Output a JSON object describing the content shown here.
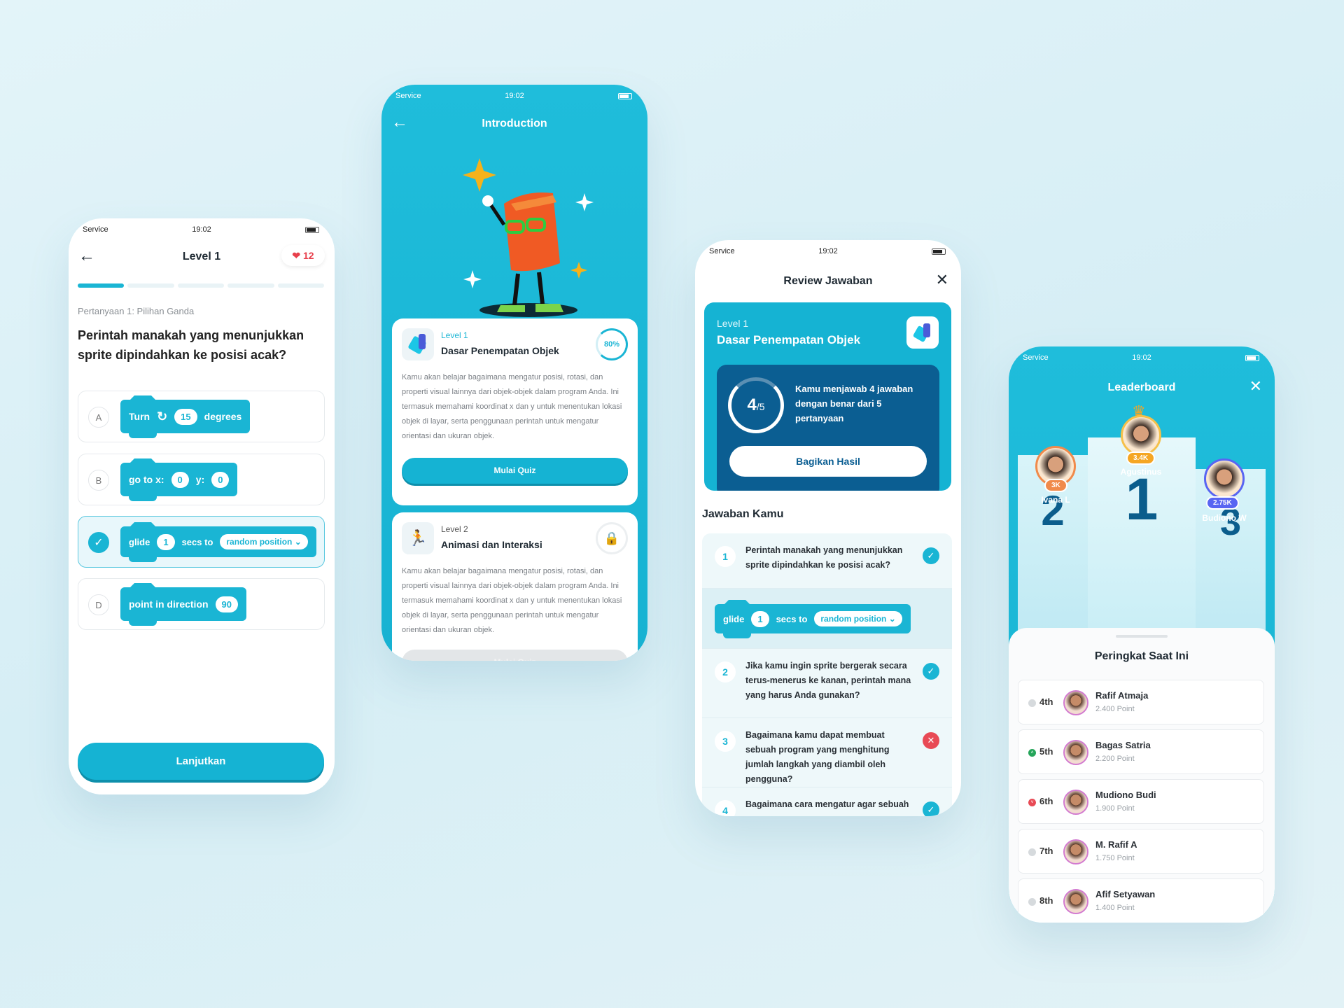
{
  "status": {
    "carrier": "Service",
    "time": "19:02"
  },
  "quiz": {
    "title": "Level 1",
    "lives": "12",
    "progress": {
      "current": 1,
      "total": 5
    },
    "question_label": "Pertanyaan 1: Pilihan Ganda",
    "question": "Perintah manakah yang menunjukkan sprite dipindahkan ke posisi acak?",
    "options": [
      {
        "letter": "A",
        "parts": [
          "Turn",
          "15",
          "degrees"
        ]
      },
      {
        "letter": "B",
        "parts": [
          "go to x:",
          "0",
          "y:",
          "0"
        ]
      },
      {
        "letter": "C",
        "selected": true,
        "parts": [
          "glide",
          "1",
          "secs to",
          "random position"
        ]
      },
      {
        "letter": "D",
        "parts": [
          "point in direction",
          "90"
        ]
      }
    ],
    "continue_label": "Lanjutkan"
  },
  "intro": {
    "title": "Introduction",
    "levels": [
      {
        "level": "Level 1",
        "name": "Dasar Penempatan Objek",
        "progress": "80%",
        "description": "Kamu akan belajar bagaimana mengatur posisi, rotasi, dan properti visual lainnya dari objek-objek dalam program Anda. Ini termasuk memahami koordinat x dan y untuk menentukan lokasi objek di layar, serta penggunaan perintah untuk mengatur orientasi dan ukuran objek.",
        "button": "Mulai Quiz"
      },
      {
        "level": "Level 2",
        "name": "Animasi dan Interaksi",
        "locked": true,
        "description": "Kamu akan belajar bagaimana mengatur posisi, rotasi, dan properti visual lainnya dari objek-objek dalam program Anda. Ini termasuk memahami koordinat x dan y untuk menentukan lokasi objek di layar, serta penggunaan perintah untuk mengatur orientasi dan ukuran objek.",
        "button": "Mulai Quiz"
      }
    ]
  },
  "review": {
    "title": "Review Jawaban",
    "level": "Level 1",
    "name": "Dasar Penempatan Objek",
    "score": "4",
    "score_total": "/5",
    "summary": "Kamu menjawab 4 jawaban dengan benar dari 5 pertanyaan",
    "share_label": "Bagikan Hasil",
    "answers_heading": "Jawaban Kamu",
    "answers": [
      {
        "n": "1",
        "q": "Perintah manakah yang menunjukkan sprite dipindahkan ke posisi acak?",
        "correct": true
      },
      {
        "n": "2",
        "q": "Jika kamu ingin sprite bergerak secara terus-menerus ke kanan, perintah mana yang harus Anda gunakan?",
        "correct": true
      },
      {
        "n": "3",
        "q": "Bagaimana kamu dapat membuat sebuah program yang menghitung jumlah langkah yang diambil oleh pengguna?",
        "correct": false
      },
      {
        "n": "4",
        "q": "Bagaimana cara mengatur agar sebuah",
        "correct": true
      }
    ],
    "answer_block": [
      "glide",
      "1",
      "secs to",
      "random position"
    ]
  },
  "leaderboard": {
    "title": "Leaderboard",
    "podium": [
      {
        "place": "1",
        "name": "Agustinus",
        "score": "3.4K"
      },
      {
        "place": "2",
        "name": "Ivana L",
        "score": "3K"
      },
      {
        "place": "3",
        "name": "Budiono W",
        "score": "2.75K"
      }
    ],
    "current_heading": "Peringkat Saat Ini",
    "rows": [
      {
        "rank": "4th",
        "name": "Rafif Atmaja",
        "points": "2.400 Point",
        "trend": "same"
      },
      {
        "rank": "5th",
        "name": "Bagas Satria",
        "points": "2.200 Point",
        "trend": "up"
      },
      {
        "rank": "6th",
        "name": "Mudiono Budi",
        "points": "1.900 Point",
        "trend": "down"
      },
      {
        "rank": "7th",
        "name": "M. Rafif A",
        "points": "1.750 Point",
        "trend": "same"
      },
      {
        "rank": "8th",
        "name": "Afif Setyawan",
        "points": "1.400 Point",
        "trend": "same"
      }
    ]
  },
  "colors": {
    "primary": "#1ab5d4",
    "dark": "#0b5d8c",
    "error": "#e84a55",
    "success": "#25a55a",
    "heart": "#e8404c"
  }
}
